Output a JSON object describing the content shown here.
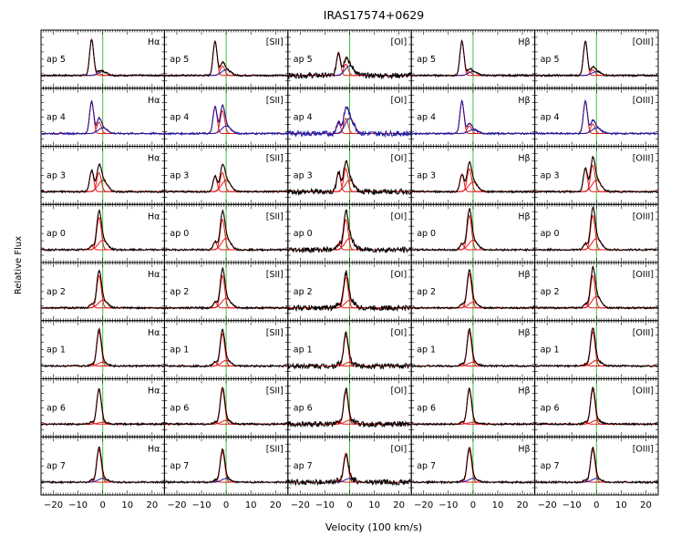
{
  "chart_data": {
    "type": "line",
    "title": "IRAS17574+0629",
    "xlabel": "Velocity (100 km/s)",
    "ylabel": "Relative Flux",
    "xlim": [
      -25,
      25
    ],
    "x_ticks": [
      -20,
      -10,
      0,
      10,
      20
    ],
    "x_tick_labels": [
      "−20",
      "−10",
      "0",
      "10",
      "20"
    ],
    "reference_line_x": 0,
    "lines": [
      "Hα",
      "[SII]",
      "[OI]",
      "Hβ",
      "[OIII]"
    ],
    "apertures": [
      "ap 5",
      "ap 4",
      "ap 3",
      "ap 0",
      "ap 2",
      "ap 1",
      "ap 6",
      "ap 7"
    ],
    "aperture_total_colors": [
      "#000000",
      "#1a1aa6",
      "#000000",
      "#000000",
      "#000000",
      "#000000",
      "#000000",
      "#000000"
    ],
    "components": [
      {
        "v": -4.5,
        "w": 0.8
      },
      {
        "v": -1.5,
        "w": 0.9
      },
      {
        "v": 0.0,
        "w": 1.8
      }
    ],
    "amplitudes": {
      "Hα": [
        [
          0.95,
          0.05,
          0.1
        ],
        [
          0.85,
          0.3,
          0.15
        ],
        [
          0.55,
          0.5,
          0.3
        ],
        [
          0.1,
          0.85,
          0.25
        ],
        [
          0.1,
          0.85,
          0.2
        ],
        [
          0.05,
          0.9,
          0.1
        ],
        [
          0.05,
          0.9,
          0.05
        ],
        [
          0.05,
          0.85,
          0.1
        ]
      ],
      "[SII]": [
        [
          0.9,
          0.25,
          0.15
        ],
        [
          0.7,
          0.6,
          0.2
        ],
        [
          0.4,
          0.5,
          0.3
        ],
        [
          0.2,
          0.8,
          0.3
        ],
        [
          0.15,
          0.85,
          0.25
        ],
        [
          0.1,
          0.85,
          0.15
        ],
        [
          0.05,
          0.9,
          0.1
        ],
        [
          0.05,
          0.8,
          0.1
        ]
      ],
      "[OI]": [
        [
          0.6,
          0.3,
          0.25
        ],
        [
          0.3,
          0.4,
          0.4
        ],
        [
          0.5,
          0.6,
          0.3
        ],
        [
          0.15,
          0.8,
          0.3
        ],
        [
          0.1,
          0.8,
          0.2
        ],
        [
          0.05,
          0.8,
          0.1
        ],
        [
          0.05,
          0.85,
          0.1
        ],
        [
          0.05,
          0.7,
          0.1
        ]
      ],
      "Hβ": [
        [
          0.9,
          0.1,
          0.1
        ],
        [
          0.85,
          0.2,
          0.1
        ],
        [
          0.45,
          0.6,
          0.25
        ],
        [
          0.15,
          0.9,
          0.25
        ],
        [
          0.1,
          0.9,
          0.15
        ],
        [
          0.05,
          0.9,
          0.1
        ],
        [
          0.05,
          0.9,
          0.05
        ],
        [
          0.05,
          0.85,
          0.1
        ]
      ],
      "[OIII]": [
        [
          0.9,
          0.15,
          0.1
        ],
        [
          0.85,
          0.25,
          0.15
        ],
        [
          0.6,
          0.7,
          0.3
        ],
        [
          0.15,
          0.9,
          0.3
        ],
        [
          0.1,
          0.85,
          0.3
        ],
        [
          0.05,
          0.9,
          0.15
        ],
        [
          0.05,
          0.9,
          0.1
        ],
        [
          0.05,
          0.85,
          0.1
        ]
      ]
    },
    "colors": {
      "total": "#000000",
      "total_ap4": "#1a1aa6",
      "fit": "#e31a1c",
      "broad_fit": "#1a1aa6",
      "zero_velocity": "#3ec43e",
      "continuum_alt": "#2e8b57"
    },
    "grid": false
  }
}
